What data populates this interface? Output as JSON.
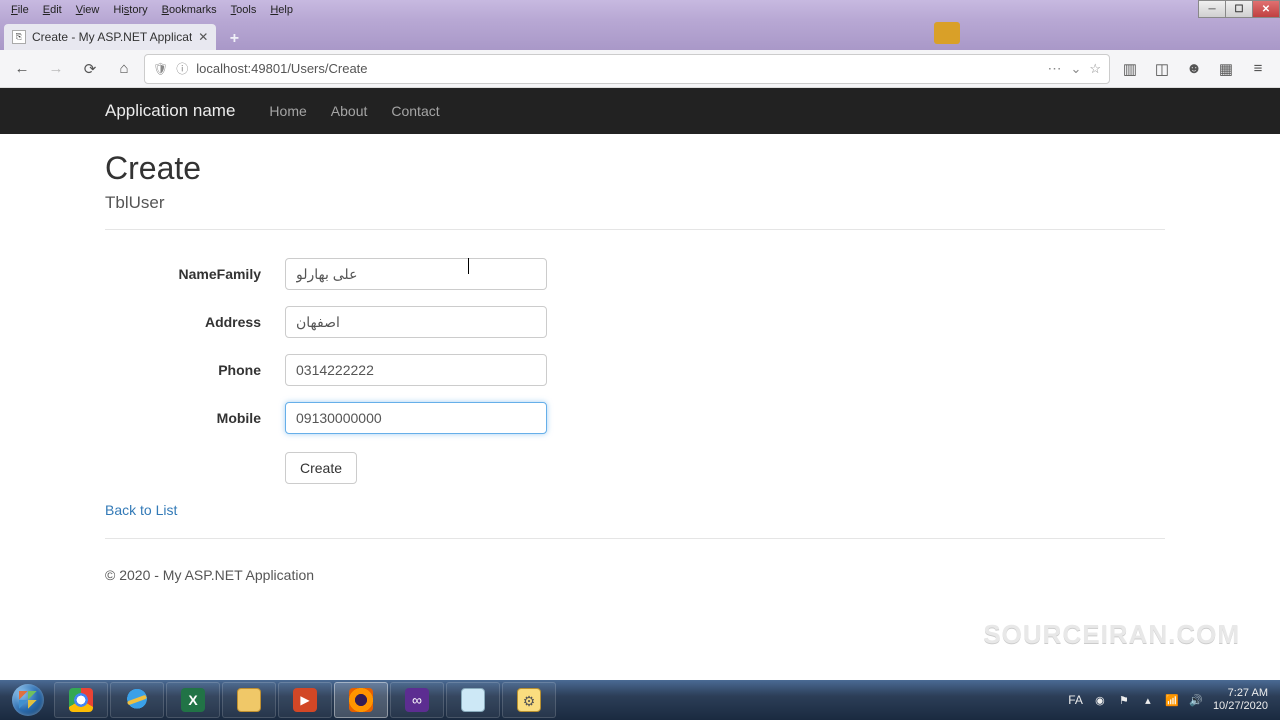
{
  "menu": {
    "file": "File",
    "edit": "Edit",
    "view": "View",
    "history": "History",
    "bookmarks": "Bookmarks",
    "tools": "Tools",
    "help": "Help"
  },
  "tab": {
    "title": "Create - My ASP.NET Applicat"
  },
  "url": "localhost:49801/Users/Create",
  "nav": {
    "brand": "Application name",
    "links": {
      "home": "Home",
      "about": "About",
      "contact": "Contact"
    }
  },
  "page": {
    "heading": "Create",
    "subhead": "TblUser",
    "labels": {
      "namefamily": "NameFamily",
      "address": "Address",
      "phone": "Phone",
      "mobile": "Mobile"
    },
    "values": {
      "namefamily": "علی بهارلو",
      "address": "اصفهان",
      "phone": "0314222222",
      "mobile": "09130000000"
    },
    "createbtn": "Create",
    "backlink": "Back to List",
    "footer": "© 2020 - My ASP.NET Application"
  },
  "watermark": "SOURCEIRAN.COM",
  "tray": {
    "lang": "FA",
    "time": "7:27 AM",
    "date": "10/27/2020"
  }
}
